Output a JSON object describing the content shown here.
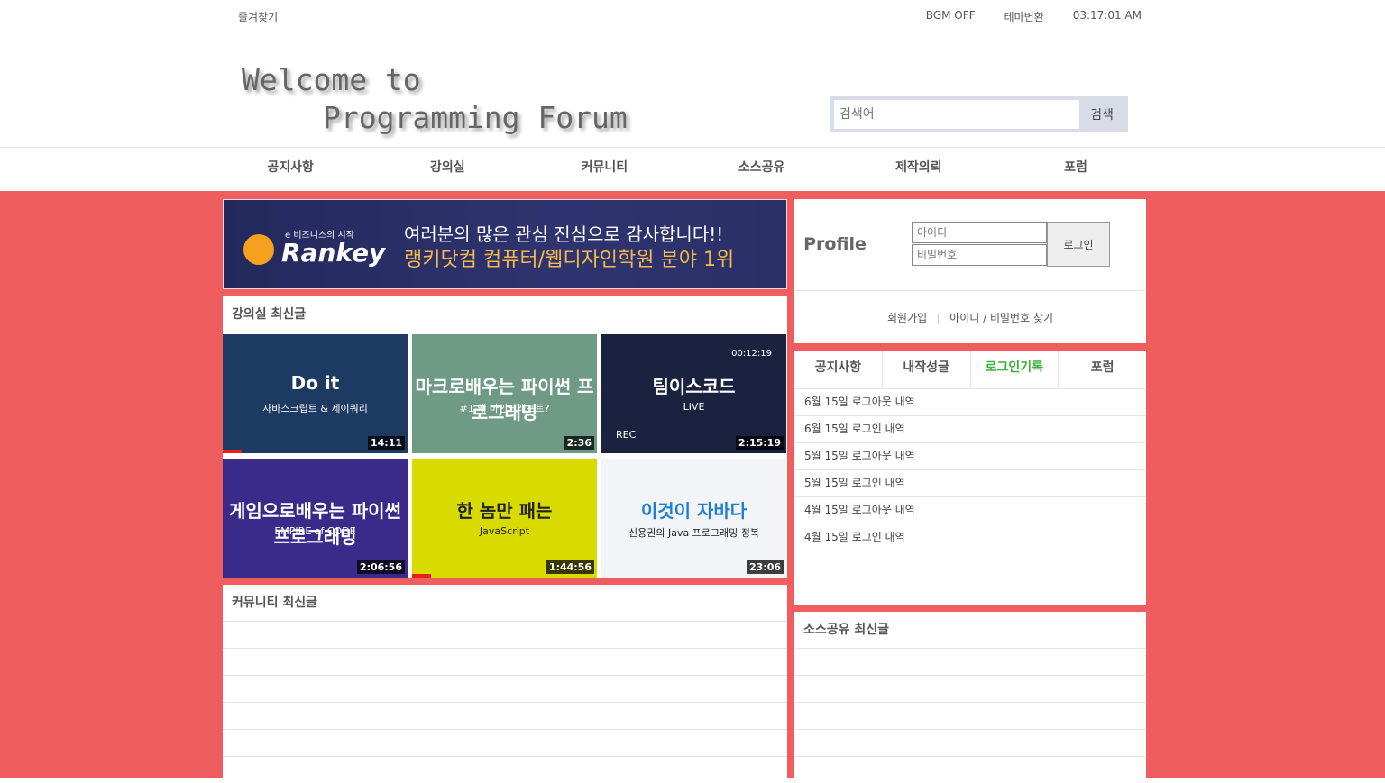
{
  "util": {
    "favorites": "즐겨찾기",
    "bgm": "BGM OFF",
    "theme": "테마변환",
    "time": "03:17:01 AM"
  },
  "logo": {
    "line1": "Welcome to",
    "line2": "Programming Forum"
  },
  "search": {
    "placeholder": "검색어",
    "button": "검색"
  },
  "nav": [
    "공지사항",
    "강의실",
    "커뮤니티",
    "소스공유",
    "제작의뢰",
    "포럼"
  ],
  "banner": {
    "small": "e 비즈니스의 시작",
    "brand": "Rankey",
    "line1": "여러분의 많은 관심 진심으로 감사합니다!!",
    "line2": "랭키닷컴 컴퓨터/웹디자인학원 분야 1위"
  },
  "lectures": {
    "title": "강의실 최신글",
    "videos": [
      {
        "title": "Do it",
        "subtitle": "자바스크립트 & 제이쿼리",
        "duration": "14:11",
        "bg": "#1d3a63",
        "progress": 0.1
      },
      {
        "title": "마크로배우는 파이썬 프로그래밍",
        "subtitle": "#1 왜 마인크래프트?",
        "duration": "2:36",
        "bg": "#6e9a86",
        "progress": 0
      },
      {
        "title": "팀이스코드",
        "subtitle": "LIVE",
        "duration": "2:15:19",
        "bg": "#1a2240",
        "progress": 0,
        "rec": "REC",
        "timer": "00:12:19"
      },
      {
        "title": "게임으로배우는 파이썬 프로그래밍",
        "subtitle": "EMPIRE of CODE",
        "duration": "2:06:56",
        "bg": "#3a2a8a",
        "progress": 0
      },
      {
        "title": "한 놈만 패는",
        "subtitle": "JavaScript",
        "duration": "1:44:56",
        "bg": "#d9db00",
        "progress": 0.1
      },
      {
        "title": "이것이 자바다",
        "subtitle": "신용권의 Java 프로그래밍 정복",
        "duration": "23:06",
        "bg": "#f2f4f7",
        "progress": 0
      }
    ]
  },
  "community": {
    "title": "커뮤니티 최신글"
  },
  "profile": {
    "label": "Profile",
    "id_placeholder": "아이디",
    "pw_placeholder": "비밀번호",
    "login": "로그인",
    "join": "회원가입",
    "find": "아이디 / 비밀번호 찾기"
  },
  "tabs": {
    "items": [
      "공지사항",
      "내작성글",
      "로그인기록",
      "포럼"
    ],
    "active": 2
  },
  "login_log": [
    "6월 15일 로그아웃 내역",
    "6월 15일 로그인 내역",
    "5월 15일 로그아웃 내역",
    "5월 15일 로그인 내역",
    "4월 15일 로그아웃 내역",
    "4월 15일 로그인 내역"
  ],
  "source": {
    "title": "소스공유 최신글"
  }
}
